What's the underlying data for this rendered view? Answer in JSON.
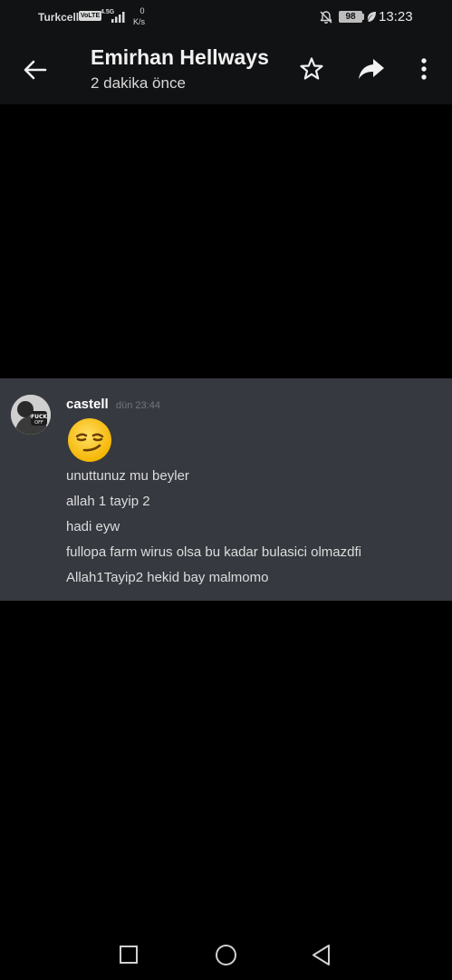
{
  "status_bar": {
    "carrier": "Turkcell",
    "volte": "VoLTE",
    "network_type": "4.5G",
    "speed_value": "0",
    "speed_unit": "K/s",
    "battery": "98",
    "time": "13:23"
  },
  "header": {
    "title": "Emirhan Hellways",
    "subtitle": "2 dakika önce",
    "icons": {
      "back": "arrow-left-icon",
      "star": "star-icon",
      "share": "share-icon",
      "more": "more-vert-icon"
    }
  },
  "image": {
    "message": {
      "username": "castell",
      "timestamp": "dün 23:44",
      "emoji": "smirking-face",
      "lines": [
        "unuttunuz mu beyler",
        "allah 1 tayip 2",
        "hadi eyw",
        "fullopa farm wirus olsa bu kadar bulasici olmazdfi",
        "Allah1Tayip2 hekid bay malmomo"
      ]
    },
    "colors": {
      "panel": "#36393f",
      "username": "#ffffff",
      "text": "#dcddde",
      "timestamp": "#72767d"
    }
  },
  "nav_bar": {
    "icons": [
      "recent-apps-icon",
      "home-icon",
      "back-triangle-icon"
    ]
  }
}
